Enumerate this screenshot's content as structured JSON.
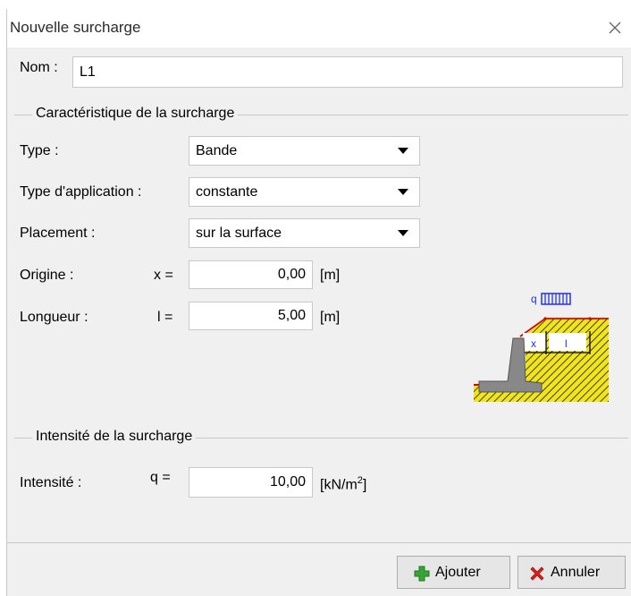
{
  "window": {
    "title": "Nouvelle surcharge"
  },
  "name": {
    "label": "Nom :",
    "value": "L1"
  },
  "characteristics": {
    "group_title": "Caractéristique de la surcharge",
    "type": {
      "label": "Type :",
      "value": "Bande"
    },
    "application": {
      "label": "Type d'application :",
      "value": "constante"
    },
    "placement": {
      "label": "Placement :",
      "value": "sur la surface"
    },
    "origin": {
      "label": "Origine :",
      "var": "x =",
      "value": "0,00",
      "unit": "[m]"
    },
    "length": {
      "label": "Longueur :",
      "var": "l =",
      "value": "5,00",
      "unit": "[m]"
    }
  },
  "diagram": {
    "q_label": "q",
    "x_label": "x",
    "l_label": "l"
  },
  "intensity": {
    "group_title": "Intensité de la surcharge",
    "label": "Intensité :",
    "var": "q =",
    "value": "10,00",
    "unit_base": "[kN/m",
    "unit_sup": "2",
    "unit_end": "]"
  },
  "buttons": {
    "add_label": "Ajouter",
    "cancel_label": "Annuler"
  },
  "colors": {
    "add_icon": "#3aa336",
    "cancel_icon": "#e02020",
    "diagram_blue": "#1f2fff",
    "diagram_hatch": "#f0e41c",
    "diagram_red": "#e00000"
  }
}
